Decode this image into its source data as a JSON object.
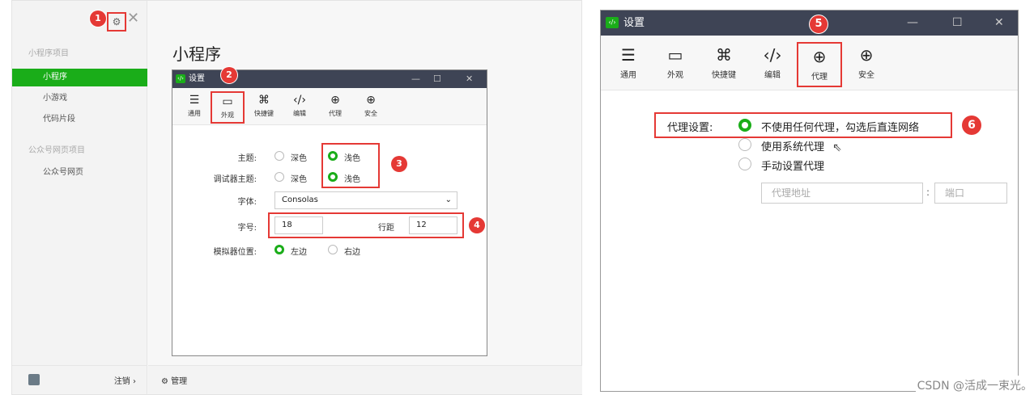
{
  "left": {
    "sidebar": {
      "section1": "小程序项目",
      "items": [
        "小程序",
        "小游戏",
        "代码片段"
      ],
      "section2": "公众号网页项目",
      "items2": [
        "公众号网页"
      ],
      "logout": "注销 ›"
    },
    "icons": {
      "gear": "⚙",
      "close": "✕"
    },
    "page_title": "小程序",
    "footer_manage": "管理",
    "badges": [
      "1",
      "2",
      "3",
      "4"
    ],
    "settings": {
      "title": "设置",
      "logo": "‹/›",
      "window_controls": {
        "min": "—",
        "max": "☐",
        "close": "✕"
      },
      "toolbar": [
        {
          "icon": "☰",
          "label": "通用"
        },
        {
          "icon": "▭",
          "label": "外观"
        },
        {
          "icon": "⌘",
          "label": "快捷键"
        },
        {
          "icon": "‹/›",
          "label": "编辑"
        },
        {
          "icon": "⊕",
          "label": "代理"
        },
        {
          "icon": "⊕",
          "label": "安全"
        }
      ],
      "theme_label": "主题:",
      "debugger_theme_label": "调试器主题:",
      "dark": "深色",
      "light": "浅色",
      "font_label": "字体:",
      "font_value": "Consolas",
      "font_size_label": "字号:",
      "font_size_value": "18",
      "line_height_label": "行距",
      "line_height_value": "12",
      "simulator_label": "模拟器位置:",
      "left_opt": "左边",
      "right_opt": "右边"
    }
  },
  "right": {
    "title": "设置",
    "logo": "‹/›",
    "window_controls": {
      "min": "—",
      "max": "☐",
      "close": "✕"
    },
    "badges": [
      "5",
      "6"
    ],
    "toolbar": [
      {
        "icon": "☰",
        "label": "通用"
      },
      {
        "icon": "▭",
        "label": "外观"
      },
      {
        "icon": "⌘",
        "label": "快捷键"
      },
      {
        "icon": "‹/›",
        "label": "编辑"
      },
      {
        "icon": "⊕",
        "label": "代理"
      },
      {
        "icon": "⊕",
        "label": "安全"
      }
    ],
    "proxy_label": "代理设置:",
    "options": [
      "不使用任何代理，勾选后直连网络",
      "使用系统代理",
      "手动设置代理"
    ],
    "address_placeholder": "代理地址",
    "colon": ":",
    "port_placeholder": "端口"
  },
  "watermark": "CSDN @活成一束光。",
  "colors": {
    "accent": "#1aad19",
    "highlight": "#e53935",
    "titlebar": "#3e4455"
  }
}
